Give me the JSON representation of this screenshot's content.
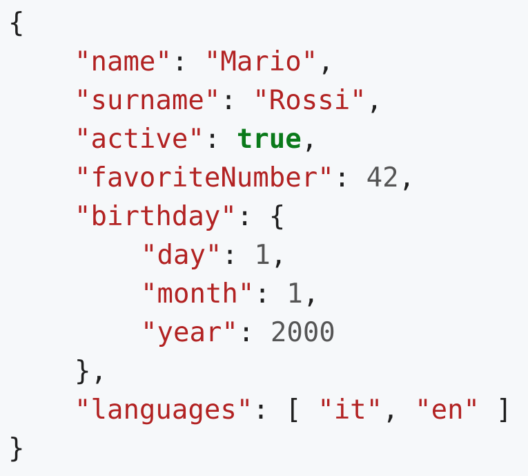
{
  "code": {
    "open_brace": "{",
    "close_brace": "}",
    "colon": ": ",
    "comma": ",",
    "fields": {
      "name": {
        "key": "\"name\"",
        "value": "\"Mario\""
      },
      "surname": {
        "key": "\"surname\"",
        "value": "\"Rossi\""
      },
      "active": {
        "key": "\"active\"",
        "value": "true"
      },
      "favoriteNumber": {
        "key": "\"favoriteNumber\"",
        "value": "42"
      },
      "birthday": {
        "key": "\"birthday\"",
        "open": "{",
        "close": "},",
        "day": {
          "key": "\"day\"",
          "value": "1"
        },
        "month": {
          "key": "\"month\"",
          "value": "1"
        },
        "year": {
          "key": "\"year\"",
          "value": "2000"
        }
      },
      "languages": {
        "key": "\"languages\"",
        "open": "[ ",
        "items": [
          "\"it\"",
          "\"en\""
        ],
        "separator": ", ",
        "close": " ]"
      }
    }
  },
  "colors": {
    "background": "#f6f8fa",
    "string": "#b22222",
    "keyword": "#0a7a1a",
    "number": "#555555",
    "punctuation": "#1f1f1f"
  }
}
